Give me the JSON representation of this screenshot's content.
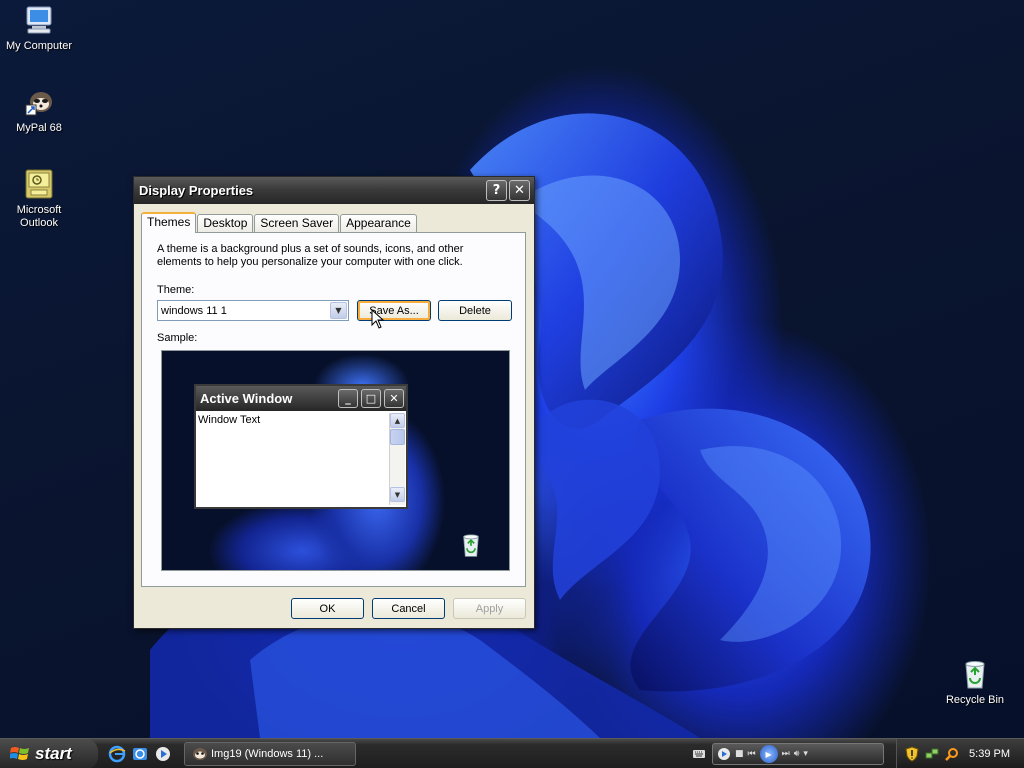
{
  "desktop": {
    "icons": [
      {
        "label": "My Computer"
      },
      {
        "label": "MyPal 68"
      },
      {
        "label": "Microsoft Outlook"
      },
      {
        "label": "Recycle Bin"
      }
    ]
  },
  "dialog": {
    "title": "Display Properties",
    "help_glyph": "?",
    "close_glyph": "✕",
    "tabs": [
      {
        "label": "Themes",
        "active": true
      },
      {
        "label": "Desktop"
      },
      {
        "label": "Screen Saver"
      },
      {
        "label": "Appearance"
      }
    ],
    "description": "A theme is a background plus a set of sounds, icons, and other elements to help you personalize your computer with one click.",
    "theme_label": "Theme:",
    "theme_value": "windows 11 1",
    "save_as_label": "Save As...",
    "delete_label": "Delete",
    "sample_label": "Sample:",
    "sample": {
      "window_title": "Active Window",
      "window_text": "Window Text"
    },
    "ok_label": "OK",
    "cancel_label": "Cancel",
    "apply_label": "Apply"
  },
  "taskbar": {
    "start_label": "start",
    "task_items": [
      {
        "label": "Img19 (Windows 11) ..."
      }
    ],
    "clock": "5:39 PM"
  },
  "colors": {
    "titlebar": "#2f2f2f",
    "dialog_face": "#ece9d8",
    "focus_ring": "#f7ac3d",
    "wallpaper_accent": "#1e3fe6"
  }
}
